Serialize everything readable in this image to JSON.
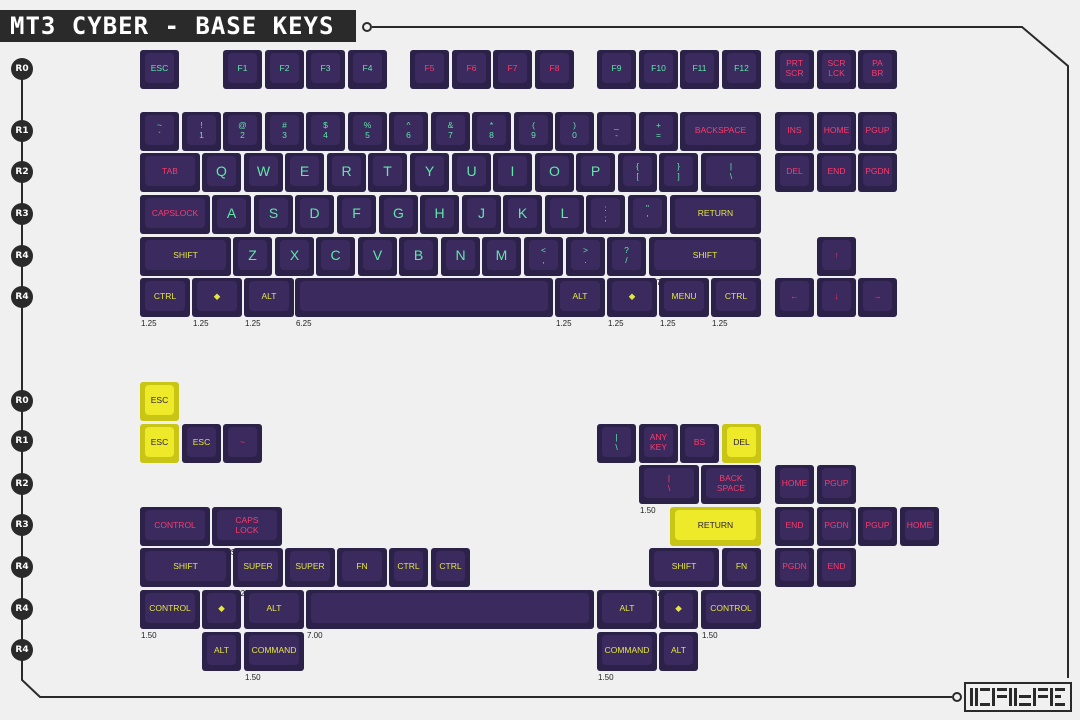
{
  "title": "MT3 CYBER - BASE KEYS",
  "colors": {
    "body": "#2c2148",
    "cap": "#3a2a5e",
    "legend_green": "#5fe8a8",
    "legend_red": "#ff3a6a",
    "legend_yellow": "#e4e640",
    "accent_yellow": "#eeea2a"
  },
  "rows": [
    {
      "label": "R0"
    },
    {
      "label": "R1"
    },
    {
      "label": "R2"
    },
    {
      "label": "R3"
    },
    {
      "label": "R4"
    },
    {
      "label": "R4"
    },
    {
      "label": "R0"
    },
    {
      "label": "R1"
    },
    {
      "label": "R2"
    },
    {
      "label": "R3"
    },
    {
      "label": "R4"
    },
    {
      "label": "R4"
    },
    {
      "label": "R4"
    }
  ],
  "keys": [
    {
      "l": "ESC",
      "c": "g"
    },
    {
      "l": "F1",
      "c": "g"
    },
    {
      "l": "F2",
      "c": "g"
    },
    {
      "l": "F3",
      "c": "g"
    },
    {
      "l": "F4",
      "c": "g"
    },
    {
      "l": "F5",
      "c": "r"
    },
    {
      "l": "F6",
      "c": "r"
    },
    {
      "l": "F7",
      "c": "r"
    },
    {
      "l": "F8",
      "c": "r"
    },
    {
      "l": "F9",
      "c": "g"
    },
    {
      "l": "F10",
      "c": "g"
    },
    {
      "l": "F11",
      "c": "g"
    },
    {
      "l": "F12",
      "c": "g"
    },
    {
      "l": "PRT\nSCR",
      "c": "r"
    },
    {
      "l": "SCR\nLCK",
      "c": "r"
    },
    {
      "l": "PA\nBR",
      "c": "r"
    },
    {
      "l": "~\n`",
      "c": "g"
    },
    {
      "l": "!\n1",
      "c": "g"
    },
    {
      "l": "@\n2",
      "c": "g"
    },
    {
      "l": "#\n3",
      "c": "g"
    },
    {
      "l": "$\n4",
      "c": "g"
    },
    {
      "l": "%\n5",
      "c": "g"
    },
    {
      "l": "^\n6",
      "c": "g"
    },
    {
      "l": "&\n7",
      "c": "g"
    },
    {
      "l": "*\n8",
      "c": "g"
    },
    {
      "l": "(\n9",
      "c": "g"
    },
    {
      "l": ")\n0",
      "c": "g"
    },
    {
      "l": "_\n-",
      "c": "g"
    },
    {
      "l": "+\n=",
      "c": "g"
    },
    {
      "l": "BACKSPACE",
      "c": "r",
      "s": "2.00"
    },
    {
      "l": "INS",
      "c": "r"
    },
    {
      "l": "HOME",
      "c": "r"
    },
    {
      "l": "PGUP",
      "c": "r"
    },
    {
      "l": "TAB",
      "c": "r",
      "s": "1.50"
    },
    {
      "l": "Q",
      "c": "g",
      "b": 1
    },
    {
      "l": "W",
      "c": "g",
      "b": 1
    },
    {
      "l": "E",
      "c": "g",
      "b": 1
    },
    {
      "l": "R",
      "c": "g",
      "b": 1
    },
    {
      "l": "T",
      "c": "g",
      "b": 1
    },
    {
      "l": "Y",
      "c": "g",
      "b": 1
    },
    {
      "l": "U",
      "c": "g",
      "b": 1
    },
    {
      "l": "I",
      "c": "g",
      "b": 1
    },
    {
      "l": "O",
      "c": "g",
      "b": 1
    },
    {
      "l": "P",
      "c": "g",
      "b": 1
    },
    {
      "l": "{\n[",
      "c": "g"
    },
    {
      "l": "}\n]",
      "c": "g"
    },
    {
      "l": "|\n\\",
      "c": "g"
    },
    {
      "l": "DEL",
      "c": "r"
    },
    {
      "l": "END",
      "c": "r"
    },
    {
      "l": "PGDN",
      "c": "r"
    },
    {
      "l": "CAPSLOCK",
      "c": "r",
      "s": "1.75"
    },
    {
      "l": "A",
      "c": "g",
      "b": 1
    },
    {
      "l": "S",
      "c": "g",
      "b": 1
    },
    {
      "l": "D",
      "c": "g",
      "b": 1
    },
    {
      "l": "F",
      "c": "g",
      "b": 1
    },
    {
      "l": "G",
      "c": "g",
      "b": 1
    },
    {
      "l": "H",
      "c": "g",
      "b": 1
    },
    {
      "l": "J",
      "c": "g",
      "b": 1
    },
    {
      "l": "K",
      "c": "g",
      "b": 1
    },
    {
      "l": "L",
      "c": "g",
      "b": 1
    },
    {
      "l": ":\n;",
      "c": "g"
    },
    {
      "l": "\"\n'",
      "c": "g"
    },
    {
      "l": "RETURN",
      "c": "y",
      "s": "2.25"
    },
    {
      "l": "SHIFT",
      "c": "y",
      "s": "2.25"
    },
    {
      "l": "Z",
      "c": "g",
      "b": 1
    },
    {
      "l": "X",
      "c": "g",
      "b": 1
    },
    {
      "l": "C",
      "c": "g",
      "b": 1
    },
    {
      "l": "V",
      "c": "g",
      "b": 1
    },
    {
      "l": "B",
      "c": "g",
      "b": 1
    },
    {
      "l": "N",
      "c": "g",
      "b": 1
    },
    {
      "l": "M",
      "c": "g",
      "b": 1
    },
    {
      "l": "<\n,",
      "c": "g"
    },
    {
      "l": ">\n.",
      "c": "g"
    },
    {
      "l": "?\n/",
      "c": "g"
    },
    {
      "l": "SHIFT",
      "c": "y",
      "s": "2.75"
    },
    {
      "l": "↑",
      "c": "r"
    },
    {
      "l": "CTRL",
      "c": "y",
      "s": "1.25"
    },
    {
      "l": "◆",
      "c": "y",
      "s": "1.25"
    },
    {
      "l": "ALT",
      "c": "y",
      "s": "1.25"
    },
    {
      "l": "",
      "c": "y",
      "s": "6.25"
    },
    {
      "l": "ALT",
      "c": "y",
      "s": "1.25"
    },
    {
      "l": "◆",
      "c": "y",
      "s": "1.25"
    },
    {
      "l": "MENU",
      "c": "y",
      "s": "1.25"
    },
    {
      "l": "CTRL",
      "c": "y",
      "s": "1.25"
    },
    {
      "l": "←",
      "c": "r"
    },
    {
      "l": "↓",
      "c": "r"
    },
    {
      "l": "→",
      "c": "r"
    },
    {
      "l": "ESC",
      "c": "d"
    },
    {
      "l": "ESC",
      "c": "d"
    },
    {
      "l": "ESC",
      "c": "y"
    },
    {
      "l": "~",
      "c": "r"
    },
    {
      "l": "|\n\\",
      "c": "g"
    },
    {
      "l": "ANY\nKEY",
      "c": "r"
    },
    {
      "l": "BS",
      "c": "r"
    },
    {
      "l": "DEL",
      "c": "d"
    },
    {
      "l": "|\n\\",
      "c": "r",
      "s": "1.50"
    },
    {
      "l": "BACK\nSPACE",
      "c": "r",
      "s": "1.50"
    },
    {
      "l": "HOME",
      "c": "r"
    },
    {
      "l": "PGUP",
      "c": "r"
    },
    {
      "l": "CONTROL",
      "c": "r",
      "s": "1.75"
    },
    {
      "l": "CAPS\nLOCK",
      "c": "r",
      "s": "1.75 STEP"
    },
    {
      "l": "RETURN",
      "c": "d",
      "s": "2.25"
    },
    {
      "l": "END",
      "c": "r"
    },
    {
      "l": "PGDN",
      "c": "r"
    },
    {
      "l": "PGUP",
      "c": "r"
    },
    {
      "l": "HOME",
      "c": "r"
    },
    {
      "l": "SHIFT",
      "c": "y",
      "s": "2.25"
    },
    {
      "l": "SUPER",
      "c": "y",
      "s": "1.25"
    },
    {
      "l": "SUPER",
      "c": "y",
      "s": "1.25"
    },
    {
      "l": "FN",
      "c": "y",
      "s": "1.25"
    },
    {
      "l": "CTRL",
      "c": "y"
    },
    {
      "l": "CTRL",
      "c": "y"
    },
    {
      "l": "SHIFT",
      "c": "y",
      "s": "1.75"
    },
    {
      "l": "FN",
      "c": "y"
    },
    {
      "l": "PGDN",
      "c": "r"
    },
    {
      "l": "END",
      "c": "r"
    },
    {
      "l": "CONTROL",
      "c": "y",
      "s": "1.50"
    },
    {
      "l": "◆",
      "c": "y"
    },
    {
      "l": "ALT",
      "c": "y"
    },
    {
      "l": "",
      "c": "y",
      "s": "7.00"
    },
    {
      "l": "ALT",
      "c": "y",
      "s": "1.50"
    },
    {
      "l": "◆",
      "c": "y"
    },
    {
      "l": "CONTROL",
      "c": "y",
      "s": "1.50"
    },
    {
      "l": "ALT",
      "c": "y"
    },
    {
      "l": "COMMAND",
      "c": "y",
      "s": "1.50"
    },
    {
      "l": "COMMAND",
      "c": "y",
      "s": "1.50"
    },
    {
      "l": "ALT",
      "c": "y"
    }
  ]
}
